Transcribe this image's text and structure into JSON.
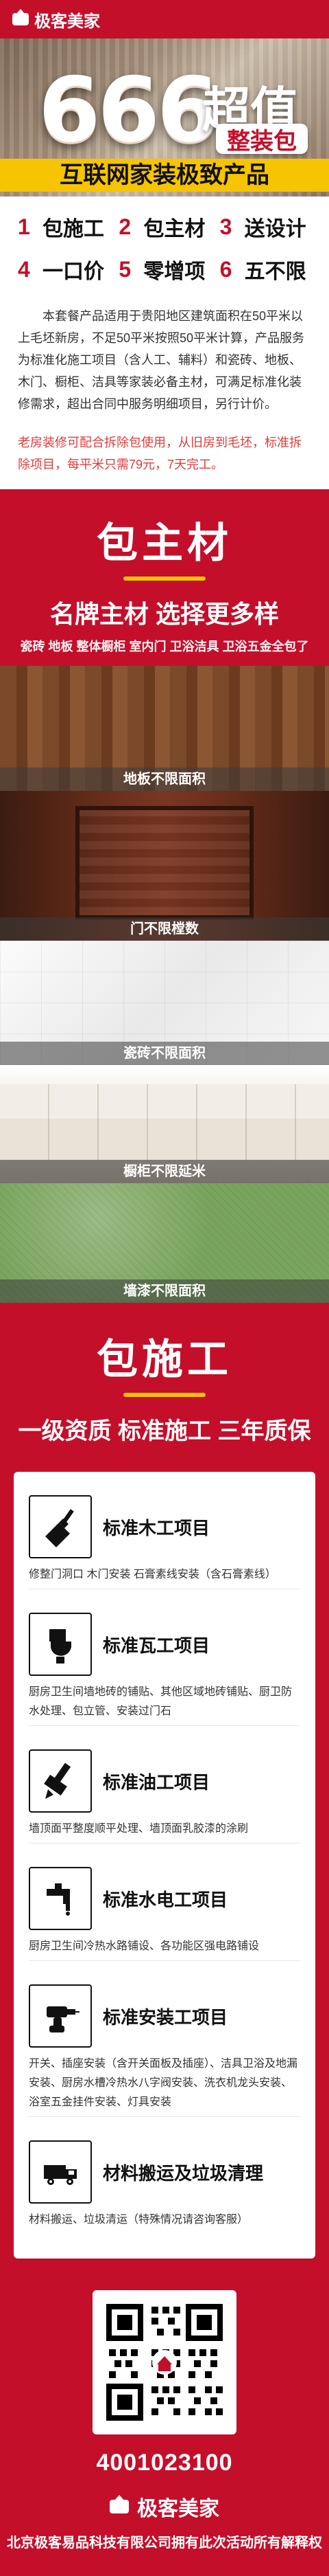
{
  "header": {
    "brand": "极客美家"
  },
  "hero": {
    "big_number": "666",
    "super_text": "超值",
    "pack_text": "整装包",
    "subtitle": "互联网家装极致产品"
  },
  "features": [
    {
      "num": "1",
      "label": "包施工"
    },
    {
      "num": "2",
      "label": "包主材"
    },
    {
      "num": "3",
      "label": "送设计"
    },
    {
      "num": "4",
      "label": "一口价"
    },
    {
      "num": "5",
      "label": "零增项"
    },
    {
      "num": "6",
      "label": "五不限"
    }
  ],
  "intro_text": "本套餐产品适用于贵阳地区建筑面积在50平米以上毛坯新房，不足50平米按照50平米计算，产品服务为标准化施工项目（含人工、辅料）和瓷砖、地板、木门、橱柜、洁具等家装必备主材，可满足标准化装修需求，超出合同中服务明细项目，另行计价。",
  "note_text": "老房装修可配合拆除包使用，从旧房到毛坯，标准拆除项目，每平米只需79元，7天完工。",
  "materials_section": {
    "title": "包主材",
    "subtitle": "名牌主材 选择更多样",
    "list": "瓷砖  地板  整体橱柜  室内门  卫浴洁具  卫浴五金全包了",
    "photos": [
      {
        "caption": "地板不限面积"
      },
      {
        "caption": "门不限樘数"
      },
      {
        "caption": "瓷砖不限面积"
      },
      {
        "caption": "橱柜不限延米"
      },
      {
        "caption": "墙漆不限面积"
      }
    ]
  },
  "construction_section": {
    "title": "包施工",
    "subtitle": "一级资质  标准施工  三年质保",
    "items": [
      {
        "icon": "trowel-icon",
        "title": "标准木工项目",
        "desc": "修整门洞口 木门安装 石膏素线安装（含石膏素线）"
      },
      {
        "icon": "toilet-icon",
        "title": "标准瓦工项目",
        "desc": "厨房卫生间墙地砖的铺贴、其他区域地砖铺贴、厨卫防水处理、包立管、安装过门石"
      },
      {
        "icon": "paint-brush-icon",
        "title": "标准油工项目",
        "desc": "墙顶面平整度顺平处理、墙顶面乳胶漆的涂刷"
      },
      {
        "icon": "faucet-icon",
        "title": "标准水电工项目",
        "desc": "厨房卫生间冷热水路铺设、各功能区强电路铺设"
      },
      {
        "icon": "drill-icon",
        "title": "标准安装工项目",
        "desc": "开关、插座安装（含开关面板及插座）、洁具卫浴及地漏安装、厨房水槽冷热水八字阀安装、洗衣机龙头安装、浴室五金挂件安装、灯具安装"
      },
      {
        "icon": "truck-icon",
        "title": "材料搬运及垃圾清理",
        "desc": "材料搬运、垃圾清运（特殊情况请咨询客服）"
      }
    ]
  },
  "footer": {
    "phone": "4001023100",
    "brand": "极客美家",
    "copyright": "北京极客易品科技有限公司拥有此次活动所有解释权"
  }
}
